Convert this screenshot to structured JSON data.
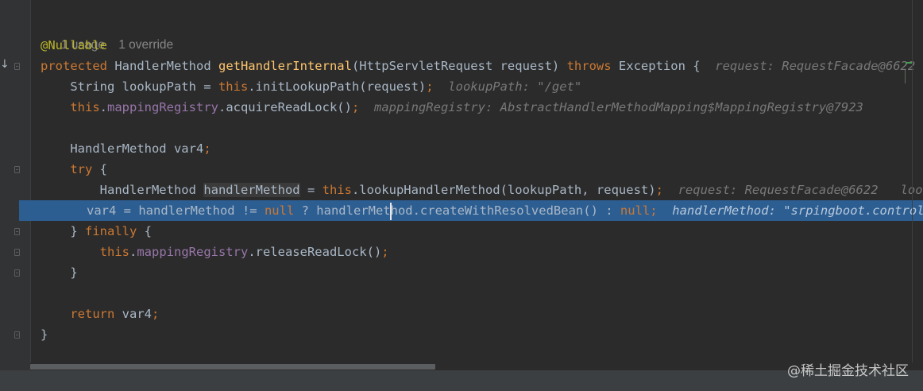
{
  "editor": {
    "usage_meta": "1 usage",
    "override_meta": "1 override",
    "annotation": "@Nullable",
    "sig": {
      "kw_protected": "protected",
      "type": " HandlerMethod ",
      "method": "getHandlerInternal",
      "params": "(HttpServletRequest request) ",
      "kw_throws": "throws",
      "exc": " Exception {",
      "hint": "request: RequestFacade@6622"
    },
    "l1": {
      "a": "String lookupPath = ",
      "this": "this",
      "b": ".initLookupPath(request)",
      "semi": ";",
      "hint": "lookupPath: \"/get\""
    },
    "l2": {
      "this": "this",
      "dot": ".",
      "field": "mappingRegistry",
      "b": ".acquireReadLock()",
      "semi": ";",
      "hint": "mappingRegistry: AbstractHandlerMethodMapping$MappingRegistry@7923"
    },
    "l3": {
      "a": "HandlerMethod var4",
      "semi": ";"
    },
    "l4": {
      "kw_try": "try",
      "b": " {"
    },
    "l5": {
      "a": "HandlerMethod ",
      "var": "handlerMethod",
      "b": " = ",
      "this": "this",
      "c": ".lookupHandlerMethod(lookupPath, request)",
      "semi": ";",
      "hint": "request: RequestFacade@6622",
      "hint2": "looku"
    },
    "l6": {
      "a": "var4 = handlerMethod != ",
      "kw_null": "null",
      "b": " ? handlerMethod.createWithResolvedBean() : ",
      "kw_null2": "null",
      "semi": ";",
      "hint": "handlerMethod: \"srpingboot.control"
    },
    "l7": {
      "a": "} ",
      "kw_finally": "finally",
      "b": " {"
    },
    "l8": {
      "this": "this",
      "dot": ".",
      "field": "mappingRegistry",
      "b": ".releaseReadLock()",
      "semi": ";"
    },
    "l9": {
      "a": "}"
    },
    "l10": {
      "kw_return": "return",
      "b": " var4",
      "semi": ";"
    },
    "l11": {
      "a": "}"
    }
  },
  "watermark": "@稀土掘金技术社区",
  "colors": {
    "background": "#2b2b2b",
    "keyword": "#cc7832",
    "method": "#ffc66d",
    "field": "#9876aa",
    "annotation": "#bbb529",
    "selection": "#2d5e92"
  }
}
